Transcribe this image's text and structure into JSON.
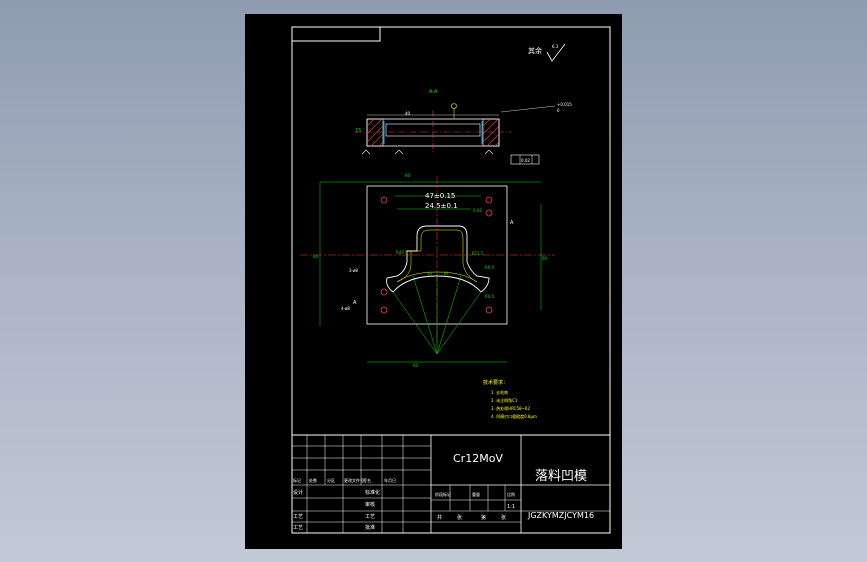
{
  "sheet": {
    "roughness_note": "其余",
    "roughness_value": "6.3",
    "section_label": "A-A",
    "view_label_a": "A",
    "view_label_a2": "A",
    "dims": {
      "overall_top": "60",
      "overall_bottom": "60",
      "width_47": "47±0.15",
      "width_24": "24.5±0.1",
      "r47": "R47.5",
      "r11": "R11.5",
      "r05a": "R0.5",
      "r05b": "R0.5",
      "angle1": "10",
      "angle2": "10",
      "left_side": "60",
      "right_side": "60",
      "hole_note": "3-ø8",
      "hole_note2": "4-ø8",
      "tol_box": "0.02",
      "flatness": "0.02",
      "section_h": "15",
      "section_dim": "40",
      "right_tol": "+0.015",
      "right_tol2": "0"
    },
    "notes": {
      "title": "技术要求：",
      "items": [
        "1. 去毛刺",
        "2. 未注倒角C1",
        "3. 热处理HRC58~62",
        "4. 凹模刃口粗糙度0.8μm"
      ]
    }
  },
  "title_block": {
    "material": "Cr12MoV",
    "part_name": "落料凹模",
    "drawing_no": "JGZKYMZJCYM16",
    "scale": "1:1",
    "labels_left": [
      "标记",
      "处数",
      "分区",
      "更改文件号",
      "签名",
      "年月日"
    ],
    "row_design": "设计",
    "row_std": "标准化",
    "row_check": "审核",
    "row_craft": "工艺",
    "row_approve": "批准",
    "row_process": "工艺",
    "stage_labels": [
      "阶段标记",
      "重量",
      "比例"
    ],
    "sheet_labels": [
      "共",
      "张",
      "第",
      "张"
    ]
  }
}
